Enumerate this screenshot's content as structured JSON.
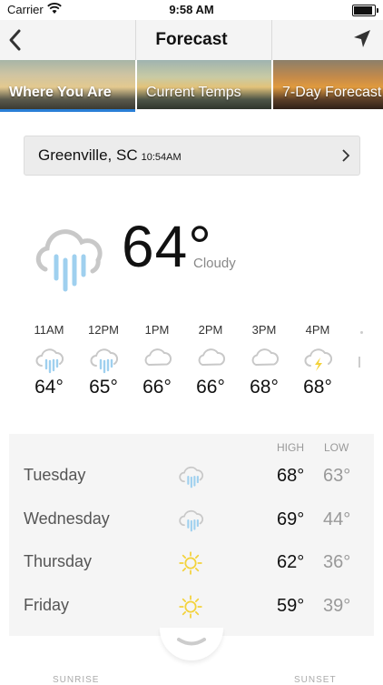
{
  "status": {
    "carrier": "Carrier",
    "time": "9:58 AM",
    "battery_level": 0.9
  },
  "nav": {
    "title": "Forecast"
  },
  "tabs": [
    {
      "label": "Where You Are",
      "active": true
    },
    {
      "label": "Current Temps",
      "active": false
    },
    {
      "label": "7-Day Forecast",
      "active": false
    }
  ],
  "location": {
    "city": "Greenville, SC",
    "time": "10:54AM"
  },
  "current": {
    "temp": "64°",
    "condition": "Cloudy",
    "icon": "rain-cloud-icon"
  },
  "hourly": [
    {
      "time": "11AM",
      "temp": "64°",
      "icon": "rain-cloud-icon"
    },
    {
      "time": "12PM",
      "temp": "65°",
      "icon": "rain-cloud-icon"
    },
    {
      "time": "1PM",
      "temp": "66°",
      "icon": "cloud-icon"
    },
    {
      "time": "2PM",
      "temp": "66°",
      "icon": "cloud-icon"
    },
    {
      "time": "3PM",
      "temp": "68°",
      "icon": "cloud-icon"
    },
    {
      "time": "4PM",
      "temp": "68°",
      "icon": "thunderstorm-icon"
    }
  ],
  "daily": {
    "high_label": "HIGH",
    "low_label": "LOW",
    "days": [
      {
        "day": "Tuesday",
        "high": "68°",
        "low": "63°",
        "icon": "rain-cloud-icon"
      },
      {
        "day": "Wednesday",
        "high": "69°",
        "low": "44°",
        "icon": "rain-cloud-icon"
      },
      {
        "day": "Thursday",
        "high": "62°",
        "low": "36°",
        "icon": "sun-icon"
      },
      {
        "day": "Friday",
        "high": "59°",
        "low": "39°",
        "icon": "sun-icon"
      }
    ]
  },
  "footer": {
    "sunrise": "SUNRISE",
    "sunset": "SUNSET"
  },
  "colors": {
    "accent": "#2a7fd6",
    "rain": "#9fd0ef",
    "sun": "#f3d23a",
    "cloud": "#c8c8c8"
  }
}
